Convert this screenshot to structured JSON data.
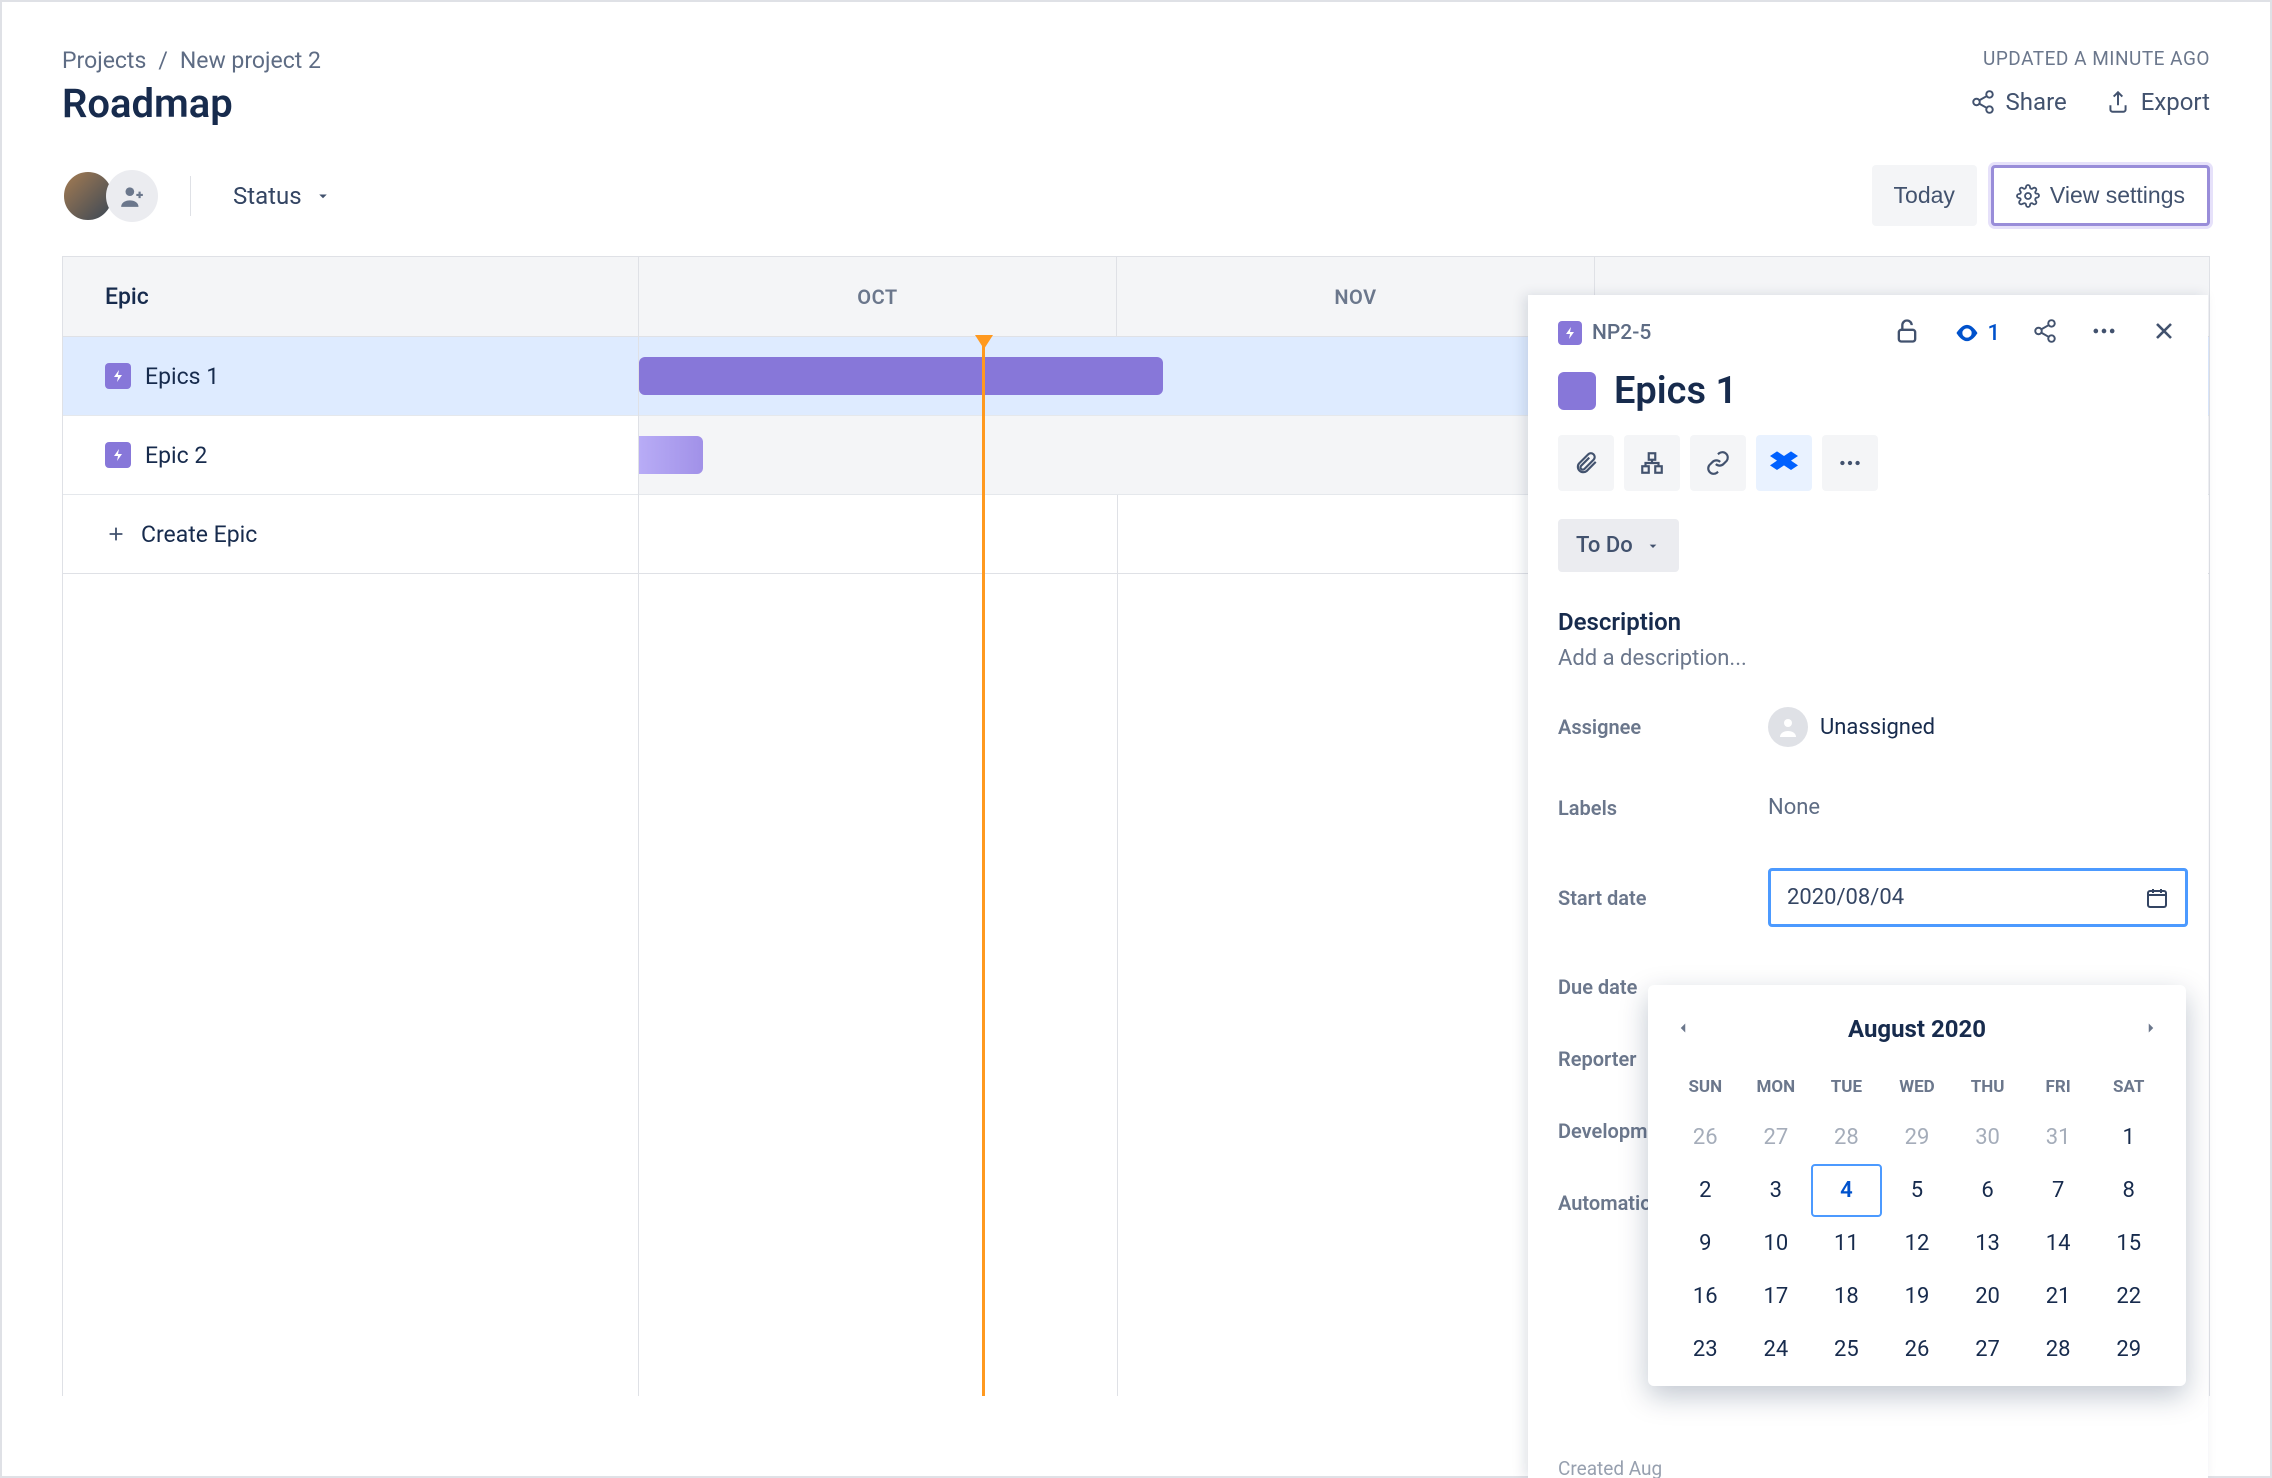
{
  "breadcrumb": {
    "projects": "Projects",
    "project": "New project 2"
  },
  "updated": "UPDATED A MINUTE AGO",
  "page_title": "Roadmap",
  "share": "Share",
  "export": "Export",
  "status_label": "Status",
  "today_btn": "Today",
  "view_settings": "View settings",
  "epic_col_header": "Epic",
  "months": {
    "oct": "OCT",
    "nov": "NOV"
  },
  "epics": [
    {
      "name": "Epics 1"
    },
    {
      "name": "Epic 2"
    }
  ],
  "create_epic": "Create Epic",
  "panel": {
    "ref": "NP2-5",
    "watchers": "1",
    "title": "Epics 1",
    "status": "To Do",
    "description_label": "Description",
    "description_placeholder": "Add a description...",
    "fields": {
      "assignee": "Assignee",
      "assignee_value": "Unassigned",
      "labels": "Labels",
      "labels_value": "None",
      "start_date": "Start date",
      "start_date_value": "2020/08/04",
      "due_date": "Due date",
      "reporter": "Reporter",
      "development": "Development",
      "automation": "Automation"
    },
    "created": "Created Aug"
  },
  "calendar": {
    "title": "August 2020",
    "dow": [
      "SUN",
      "MON",
      "TUE",
      "WED",
      "THU",
      "FRI",
      "SAT"
    ],
    "prev_trail": [
      26,
      27,
      28,
      29,
      30,
      31
    ],
    "days": [
      1,
      2,
      3,
      4,
      5,
      6,
      7,
      8,
      9,
      10,
      11,
      12,
      13,
      14,
      15,
      16,
      17,
      18,
      19,
      20,
      21,
      22,
      23,
      24,
      25,
      26,
      27,
      28,
      29
    ],
    "today": 4
  }
}
